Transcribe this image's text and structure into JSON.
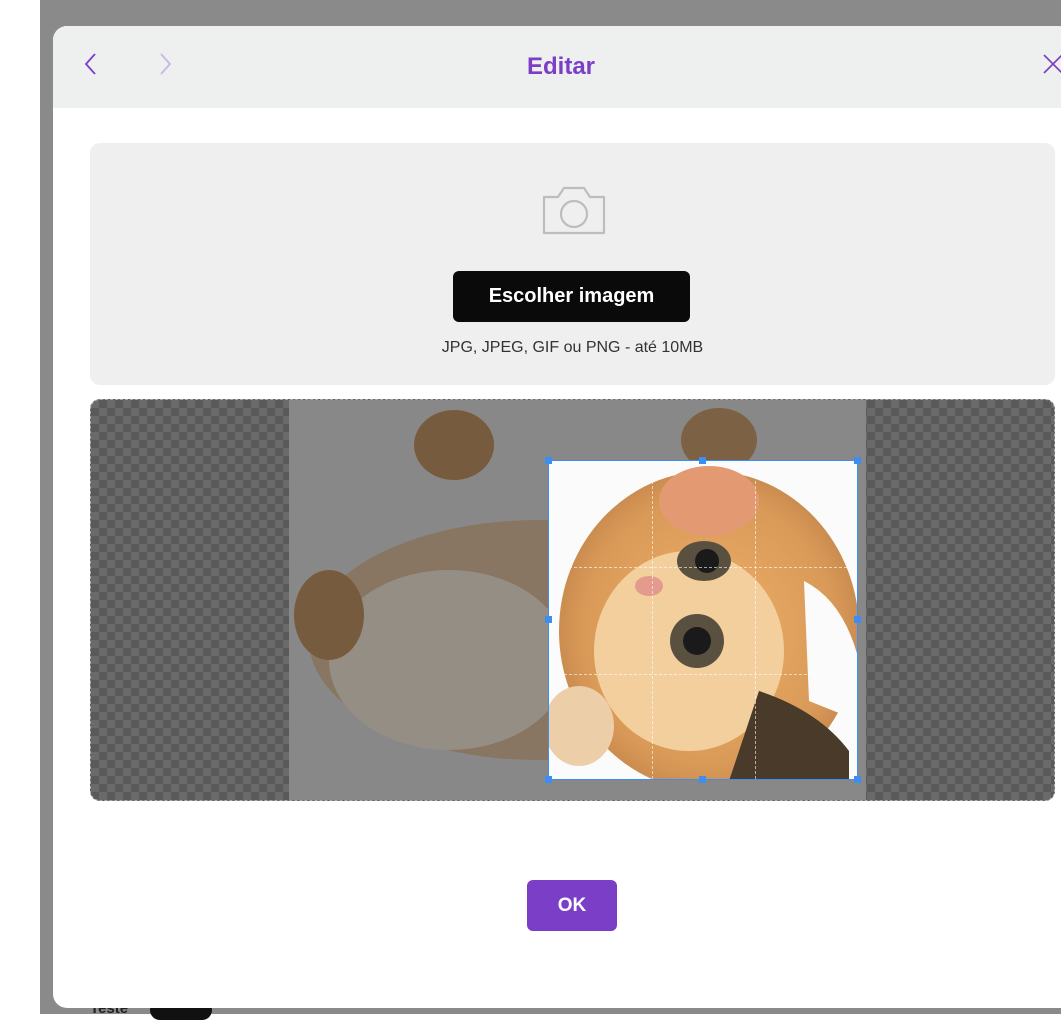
{
  "modal": {
    "title": "Editar",
    "prev_icon": "chevron-left-icon",
    "next_icon": "chevron-right-icon",
    "close_icon": "close-icon",
    "title_color": "#7b3fc7"
  },
  "upload": {
    "icon": "camera-icon",
    "choose_button": "Escolher imagem",
    "hint": "JPG, JPEG, GIF ou PNG - até 10MB"
  },
  "cropper": {
    "image": "kitten-photo",
    "selection_color": "#3d8ef0"
  },
  "actions": {
    "ok_label": "OK",
    "ok_color": "#7b3fc7"
  },
  "background": {
    "partial_text": "Teste"
  }
}
